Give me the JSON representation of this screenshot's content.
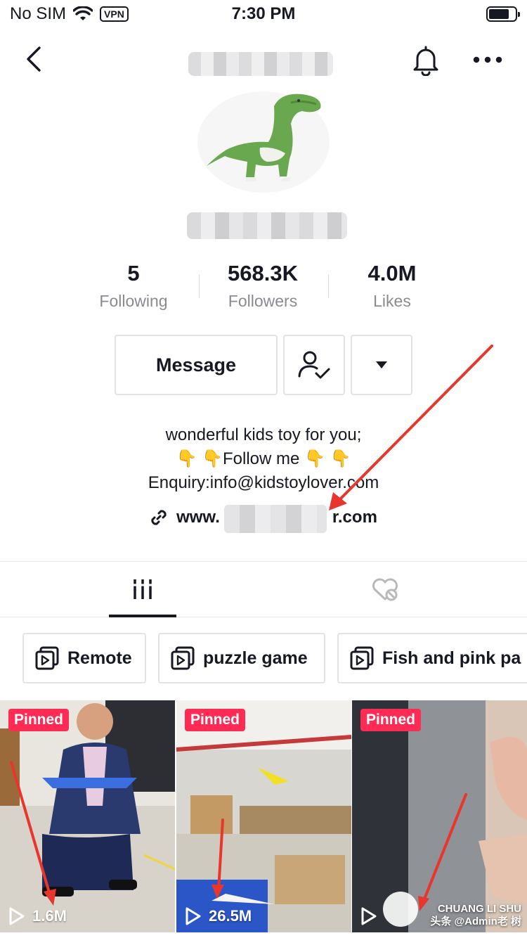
{
  "status_bar": {
    "carrier": "No SIM",
    "vpn": "VPN",
    "time": "7:30 PM"
  },
  "profile": {
    "stats": [
      {
        "value": "5",
        "label": "Following"
      },
      {
        "value": "568.3K",
        "label": "Followers"
      },
      {
        "value": "4.0M",
        "label": "Likes"
      }
    ],
    "actions": {
      "message_label": "Message"
    },
    "bio": {
      "line1": "wonderful kids toy for you;",
      "line2_text": "Follow me",
      "line2_emoji": "👇",
      "line3": "Enquiry:info@kidstoylover.com"
    },
    "link": {
      "prefix": "www.",
      "suffix": "r.com"
    }
  },
  "playlists": [
    {
      "label": "Remote"
    },
    {
      "label": "puzzle game"
    },
    {
      "label": "Fish and pink pa"
    }
  ],
  "videos": [
    {
      "badge": "Pinned",
      "views": "1.6M"
    },
    {
      "badge": "Pinned",
      "views": "26.5M"
    },
    {
      "badge": "Pinned",
      "views": ""
    }
  ],
  "watermark": {
    "line1": "CHUANG LI SHU",
    "line2": "头条 @Admin老 树"
  },
  "colors": {
    "pinned": "#fe2c55",
    "annotation_arrow": "#e8362c",
    "text_primary": "#161823",
    "text_secondary": "#8a8b91"
  },
  "icons": [
    "back-icon",
    "bell-icon",
    "more-icon",
    "wifi-icon",
    "battery-icon",
    "follow-check-icon",
    "caret-down-icon",
    "link-icon",
    "grid-videos-icon",
    "liked-hidden-icon",
    "playlist-icon",
    "play-icon"
  ]
}
